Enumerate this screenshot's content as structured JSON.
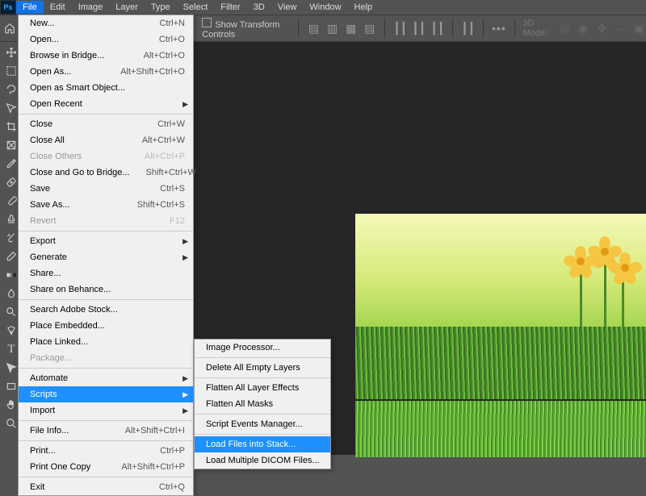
{
  "menubar": {
    "items": [
      "File",
      "Edit",
      "Image",
      "Layer",
      "Type",
      "Select",
      "Filter",
      "3D",
      "View",
      "Window",
      "Help"
    ],
    "active_index": 0
  },
  "options_bar": {
    "auto_select_label": "Show Transform Controls",
    "threed_mode_label": "3D Mode:"
  },
  "file_menu": [
    {
      "label": "New...",
      "shortcut": "Ctrl+N"
    },
    {
      "label": "Open...",
      "shortcut": "Ctrl+O"
    },
    {
      "label": "Browse in Bridge...",
      "shortcut": "Alt+Ctrl+O"
    },
    {
      "label": "Open As...",
      "shortcut": "Alt+Shift+Ctrl+O"
    },
    {
      "label": "Open as Smart Object..."
    },
    {
      "label": "Open Recent",
      "submenu": true
    },
    {
      "sep": true
    },
    {
      "label": "Close",
      "shortcut": "Ctrl+W"
    },
    {
      "label": "Close All",
      "shortcut": "Alt+Ctrl+W"
    },
    {
      "label": "Close Others",
      "shortcut": "Alt+Ctrl+P",
      "disabled": true
    },
    {
      "label": "Close and Go to Bridge...",
      "shortcut": "Shift+Ctrl+W"
    },
    {
      "label": "Save",
      "shortcut": "Ctrl+S"
    },
    {
      "label": "Save As...",
      "shortcut": "Shift+Ctrl+S"
    },
    {
      "label": "Revert",
      "shortcut": "F12",
      "disabled": true
    },
    {
      "sep": true
    },
    {
      "label": "Export",
      "submenu": true
    },
    {
      "label": "Generate",
      "submenu": true
    },
    {
      "label": "Share..."
    },
    {
      "label": "Share on Behance..."
    },
    {
      "sep": true
    },
    {
      "label": "Search Adobe Stock..."
    },
    {
      "label": "Place Embedded..."
    },
    {
      "label": "Place Linked..."
    },
    {
      "label": "Package...",
      "disabled": true
    },
    {
      "sep": true
    },
    {
      "label": "Automate",
      "submenu": true
    },
    {
      "label": "Scripts",
      "submenu": true,
      "selected": true
    },
    {
      "label": "Import",
      "submenu": true
    },
    {
      "sep": true
    },
    {
      "label": "File Info...",
      "shortcut": "Alt+Shift+Ctrl+I"
    },
    {
      "sep": true
    },
    {
      "label": "Print...",
      "shortcut": "Ctrl+P"
    },
    {
      "label": "Print One Copy",
      "shortcut": "Alt+Shift+Ctrl+P"
    },
    {
      "sep": true
    },
    {
      "label": "Exit",
      "shortcut": "Ctrl+Q"
    }
  ],
  "scripts_menu": [
    {
      "label": "Image Processor..."
    },
    {
      "sep": true
    },
    {
      "label": "Delete All Empty Layers"
    },
    {
      "sep": true
    },
    {
      "label": "Flatten All Layer Effects"
    },
    {
      "label": "Flatten All Masks"
    },
    {
      "sep": true
    },
    {
      "label": "Script Events Manager..."
    },
    {
      "sep": true
    },
    {
      "label": "Load Files into Stack...",
      "selected": true
    },
    {
      "label": "Load Multiple DICOM Files..."
    }
  ],
  "tools": [
    "move",
    "marquee",
    "lasso",
    "quick-select",
    "crop",
    "frame",
    "eyedropper",
    "healing",
    "brush",
    "stamp",
    "history",
    "eraser",
    "gradient",
    "blur",
    "dodge",
    "pen",
    "type",
    "path",
    "rectangle",
    "hand",
    "zoom"
  ]
}
